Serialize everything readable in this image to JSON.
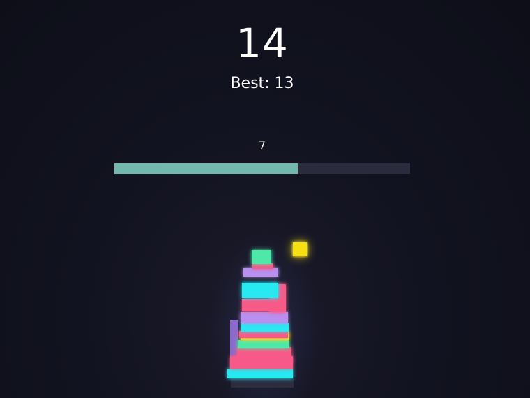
{
  "hud": {
    "score": "14",
    "best_label": "Best: 13",
    "level_number": "7",
    "level_progress": 0.62
  },
  "colors": {
    "background": "#101120",
    "progress_fill": "#72b8ae",
    "progress_track": "#2a2b3d",
    "gem": "#f7e012",
    "mint": "#4ee8a8",
    "cyan": "#28e8f0",
    "pink": "#f85a88",
    "lavender": "#b890f0",
    "yellow": "#eaf028",
    "purple": "#9f78e8"
  },
  "tower": {
    "stack_order_top_to_bottom": [
      "mint",
      "pink",
      "lavender",
      "cyan",
      "pink",
      "pink",
      "lavender",
      "cyan",
      "pink",
      "yellow",
      "mint",
      "pink",
      "pink",
      "cyan"
    ],
    "falling_piece": "gem"
  }
}
